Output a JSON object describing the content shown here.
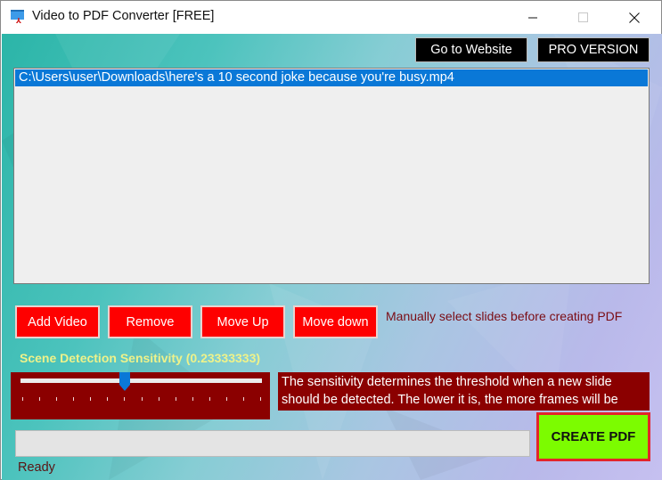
{
  "window": {
    "title": "Video to PDF Converter [FREE]",
    "icon": "app-video-pdf-icon",
    "controls": {
      "minimize": "minimize-icon",
      "maximize": "maximize-icon",
      "close": "close-icon"
    }
  },
  "header": {
    "website_button": "Go to Website",
    "pro_button": "PRO VERSION"
  },
  "file_list": {
    "items": [
      {
        "path": "C:\\Users\\user\\Downloads\\here's a 10 second joke because you're busy.mp4",
        "selected": true
      }
    ]
  },
  "actions": {
    "add_video": "Add Video",
    "remove": "Remove",
    "move_up": "Move Up",
    "move_down": "Move down",
    "manual_select": "Manually select slides before creating PDF"
  },
  "sensitivity": {
    "label": "Scene Detection Sensitivity (0.23333333)",
    "value": 0.23333333,
    "slider_position_fraction": 0.43,
    "tick_count": 15,
    "description": "The sensitivity determines the threshold when a new slide should be detected. The lower it is, the more frames will be"
  },
  "progress": {
    "value_percent": 0
  },
  "create_button": "CREATE PDF",
  "status": "Ready",
  "colors": {
    "accent_red": "#fe0000",
    "dark_red": "#8b0000",
    "create_green": "#7cfc00",
    "selection_blue": "#0a78d7",
    "label_yellow": "#eef28a"
  }
}
